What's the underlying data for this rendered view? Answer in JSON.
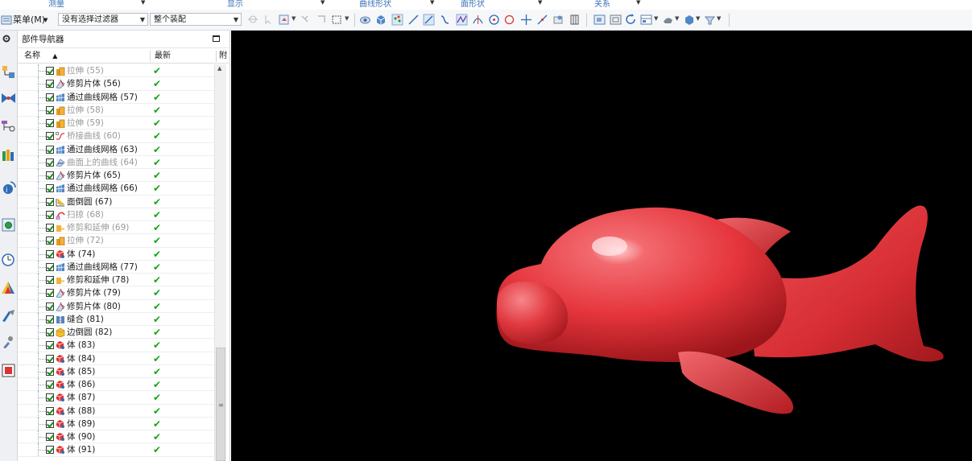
{
  "ribbon_groups": [
    "测量",
    "显示",
    "曲线形状",
    "面形状",
    "关系"
  ],
  "toolbar": {
    "menu_label": "菜单(M)",
    "selection_filter": "没有选择过滤器",
    "assembly_scope": "整个装配"
  },
  "navigator": {
    "title": "部件导航器",
    "col_name": "名称",
    "col_latest": "最新",
    "col_extra": "附",
    "rows": [
      {
        "label": "拉伸 (55)",
        "icon": "extrude-icon",
        "dim": true
      },
      {
        "label": "修剪片体 (56)",
        "icon": "trim-sheet-icon",
        "dim": false
      },
      {
        "label": "通过曲线网格 (57)",
        "icon": "curve-mesh-icon",
        "dim": false
      },
      {
        "label": "拉伸 (58)",
        "icon": "extrude-icon",
        "dim": true
      },
      {
        "label": "拉伸 (59)",
        "icon": "extrude-icon",
        "dim": true
      },
      {
        "label": "桥接曲线 (60)",
        "icon": "bridge-curve-icon",
        "dim": true
      },
      {
        "label": "通过曲线网格 (63)",
        "icon": "curve-mesh-icon",
        "dim": false
      },
      {
        "label": "曲面上的曲线 (64)",
        "icon": "curve-on-surface-icon",
        "dim": true
      },
      {
        "label": "修剪片体 (65)",
        "icon": "trim-sheet-icon",
        "dim": false
      },
      {
        "label": "通过曲线网格 (66)",
        "icon": "curve-mesh-icon",
        "dim": false
      },
      {
        "label": "面倒圆 (67)",
        "icon": "face-blend-icon",
        "dim": false
      },
      {
        "label": "扫掠 (68)",
        "icon": "swept-icon",
        "dim": true
      },
      {
        "label": "修剪和延伸 (69)",
        "icon": "trim-extend-icon",
        "dim": true
      },
      {
        "label": "拉伸 (72)",
        "icon": "extrude-icon",
        "dim": true
      },
      {
        "label": "体 (74)",
        "icon": "body-icon",
        "dim": false
      },
      {
        "label": "通过曲线网格 (77)",
        "icon": "curve-mesh-icon",
        "dim": false
      },
      {
        "label": "修剪和延伸 (78)",
        "icon": "trim-extend-icon",
        "dim": false
      },
      {
        "label": "修剪片体 (79)",
        "icon": "trim-sheet-icon",
        "dim": false
      },
      {
        "label": "修剪片体 (80)",
        "icon": "trim-sheet-icon",
        "dim": false
      },
      {
        "label": "缝合 (81)",
        "icon": "sew-icon",
        "dim": false
      },
      {
        "label": "边倒圆 (82)",
        "icon": "edge-blend-icon",
        "dim": false
      },
      {
        "label": "体 (83)",
        "icon": "body-icon",
        "dim": false
      },
      {
        "label": "体 (84)",
        "icon": "body-icon",
        "dim": false
      },
      {
        "label": "体 (85)",
        "icon": "body-icon",
        "dim": false
      },
      {
        "label": "体 (86)",
        "icon": "body-icon",
        "dim": false
      },
      {
        "label": "体 (87)",
        "icon": "body-icon",
        "dim": false
      },
      {
        "label": "体 (88)",
        "icon": "body-icon",
        "dim": false
      },
      {
        "label": "体 (89)",
        "icon": "body-icon",
        "dim": false
      },
      {
        "label": "体 (90)",
        "icon": "body-icon",
        "dim": false
      },
      {
        "label": "体 (91)",
        "icon": "body-icon",
        "dim": false
      }
    ]
  },
  "colors": {
    "model": "#e9393f",
    "viewport_bg": "#000000",
    "check": "#17a317",
    "ribbon_text": "#3c74b8"
  }
}
